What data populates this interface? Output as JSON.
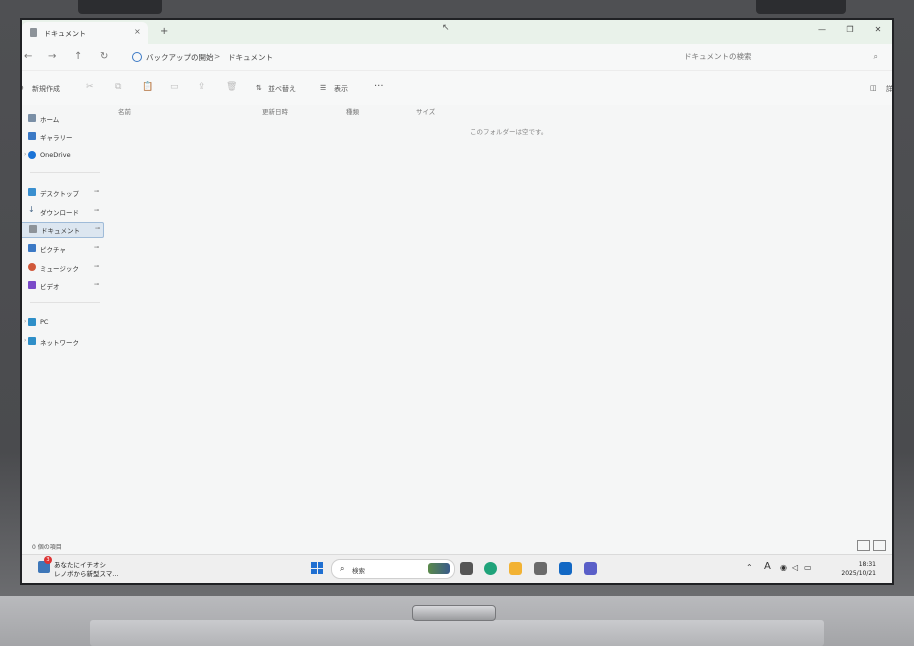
{
  "window": {
    "tab_title": "ドキュメント",
    "tab_close": "×",
    "new_tab": "+",
    "minimize": "—",
    "maximize": "❐",
    "close": "✕"
  },
  "nav": {
    "back": "←",
    "forward": "→",
    "up": "↑",
    "refresh": "↻",
    "breadcrumb": [
      "バックアップの開始",
      "ドキュメント"
    ],
    "separator": ">",
    "search_placeholder": "ドキュメントの検索"
  },
  "toolbar": {
    "new_label": "新規作成",
    "sort_label": "並べ替え",
    "view_label": "表示",
    "more_label": "···",
    "details_label": "詳細"
  },
  "sidebar": {
    "items": [
      {
        "label": "ホーム",
        "pinned": false,
        "expandable": false,
        "icon": "home-icon",
        "color": "#7a8fa6"
      },
      {
        "label": "ギャラリー",
        "pinned": false,
        "expandable": false,
        "icon": "gallery-icon",
        "color": "#3b79c5"
      },
      {
        "label": "OneDrive",
        "pinned": false,
        "expandable": true,
        "icon": "onedrive-icon",
        "color": "#1a73d6"
      },
      {
        "label": "デスクトップ",
        "pinned": true,
        "expandable": false,
        "icon": "desktop-icon",
        "color": "#3a8fcf"
      },
      {
        "label": "ダウンロード",
        "pinned": true,
        "expandable": false,
        "icon": "download-icon",
        "color": "#4a6a8a"
      },
      {
        "label": "ドキュメント",
        "pinned": true,
        "expandable": false,
        "icon": "document-icon",
        "color": "#8d9399"
      },
      {
        "label": "ピクチャ",
        "pinned": true,
        "expandable": false,
        "icon": "picture-icon",
        "color": "#3b79c5"
      },
      {
        "label": "ミュージック",
        "pinned": true,
        "expandable": false,
        "icon": "music-icon",
        "color": "#d0583a"
      },
      {
        "label": "ビデオ",
        "pinned": true,
        "expandable": false,
        "icon": "video-icon",
        "color": "#7a4ac8"
      },
      {
        "label": "PC",
        "pinned": false,
        "expandable": true,
        "icon": "pc-icon",
        "color": "#2f8fc8"
      },
      {
        "label": "ネットワーク",
        "pinned": false,
        "expandable": true,
        "icon": "network-icon",
        "color": "#2f8fc8"
      }
    ],
    "selected_index": 5,
    "pin_glyph": "📌"
  },
  "content": {
    "columns": [
      "名前",
      "更新日時",
      "種類",
      "サイズ"
    ],
    "empty_message": "このフォルダーは空です。"
  },
  "status": {
    "item_count": "0 個の項目"
  },
  "taskbar": {
    "weather_badge": "3",
    "weather_line1": "あなたにイチオシ",
    "weather_line2": "レノボから新型スマ...",
    "search_label": "検索",
    "ime": "A",
    "time": "18:31",
    "date": "2025/10/21"
  },
  "colors": {
    "titlebar_bg": "#e9f2ea",
    "selection_bg": "#dce6f0",
    "accent": "#1f6fd1"
  }
}
